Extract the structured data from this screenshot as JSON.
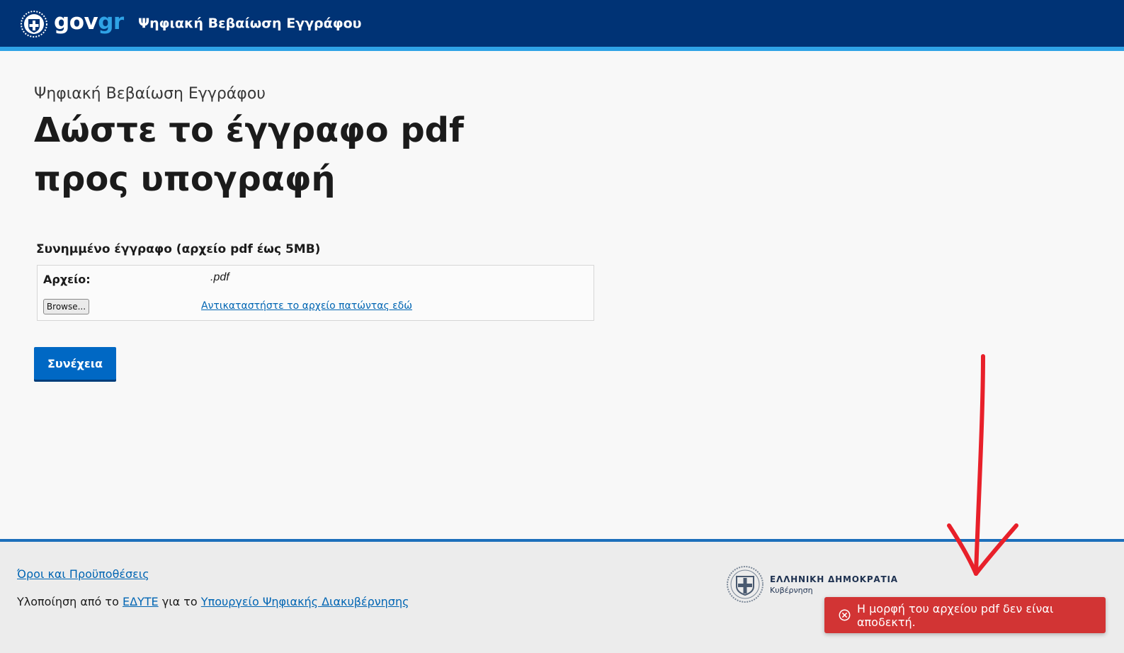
{
  "header": {
    "logo": {
      "text_gov": "gov",
      "text_gr": "gr",
      "icon": "greek-emblem-icon"
    },
    "title": "Ψηφιακή Βεβαίωση Εγγράφου"
  },
  "main": {
    "caption": "Ψηφιακή Βεβαίωση Εγγράφου",
    "title": "Δώστε το έγγραφο pdf προς υπογραφή",
    "file_field": {
      "label": "Συνημμένο έγγραφο (αρχείο pdf έως 5MB)",
      "file_key": "Αρχείο:",
      "file_name": ".pdf",
      "browse_label": "Browse...",
      "replace_link": "Αντικαταστήστε το αρχείο πατώντας εδώ"
    },
    "continue_label": "Συνέχεια"
  },
  "footer": {
    "terms_link": "Όροι και Προϋποθέσεις",
    "impl_prefix": "Υλοποίηση από το",
    "impl_org": "ΕΔΥΤΕ",
    "impl_middle": "για το",
    "impl_ministry": "Υπουργείο Ψηφιακής Διακυβέρνησης",
    "brand_name": "ΕΛΛΗΝΙΚΗ ΔΗΜΟΚΡΑΤΙΑ",
    "brand_sub": "Κυβέρνηση"
  },
  "toast": {
    "message": "Η μορφή του αρχείου pdf δεν είναι αποδεκτή.",
    "icon": "close-circle-icon"
  },
  "colors": {
    "header_bg": "#003375",
    "accent": "#2fa3e6",
    "primary_button": "#0068c4",
    "link": "#0065b3",
    "error": "#d23434",
    "annotation": "#e8202a"
  }
}
